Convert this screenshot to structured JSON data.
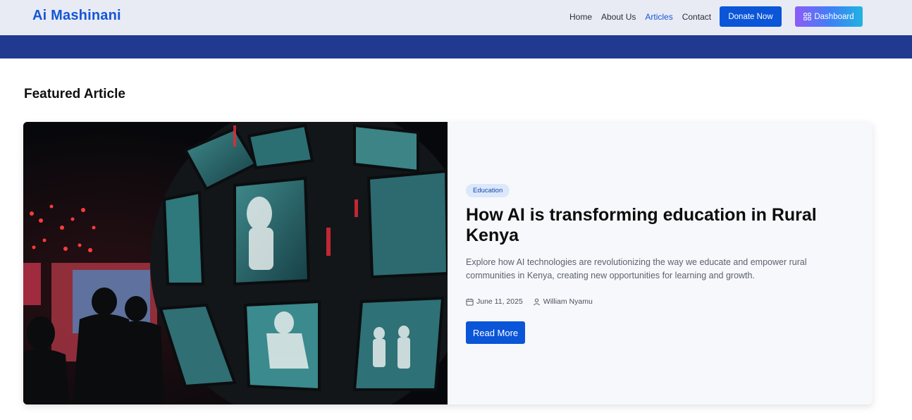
{
  "header": {
    "brand": "Ai Mashinani",
    "nav": [
      {
        "label": "Home",
        "active": false
      },
      {
        "label": "About Us",
        "active": false
      },
      {
        "label": "Articles",
        "active": true
      },
      {
        "label": "Contact",
        "active": false
      }
    ],
    "donate_label": "Donate Now",
    "dashboard_label": "Dashboard",
    "dashboard_icon": "grid-icon"
  },
  "section": {
    "title": "Featured Article"
  },
  "featured": {
    "image_desc_icon": "photo-icon",
    "tag": "Education",
    "title": "How AI is transforming education in Rural Kenya",
    "excerpt": "Explore how AI technologies are revolutionizing the way we educate and empower rural communities in Kenya, creating new opportunities for learning and growth.",
    "date": "June 11, 2025",
    "date_icon": "calendar-icon",
    "author": "William Nyamu",
    "author_icon": "user-icon",
    "read_more_label": "Read More"
  },
  "colors": {
    "brand": "#1556d6",
    "primary_button": "#0a55d8",
    "hero_band": "#1f3a8f",
    "nav_bg": "#e8ebf4",
    "tag_bg": "#dbe8fb"
  }
}
